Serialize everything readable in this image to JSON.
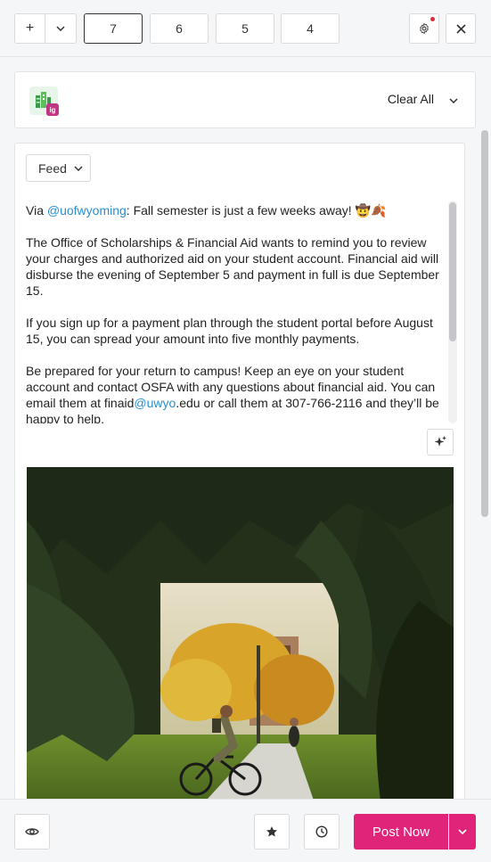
{
  "toolbar": {
    "add_label": "+",
    "tabs": [
      {
        "label": "7",
        "active": true
      },
      {
        "label": "6",
        "active": false
      },
      {
        "label": "5",
        "active": false
      },
      {
        "label": "4",
        "active": false
      }
    ]
  },
  "account": {
    "network_badge": "ig",
    "clear_all": "Clear All"
  },
  "editor": {
    "feed_label": "Feed",
    "caption": {
      "p1_prefix": "Via ",
      "p1_mention": "@uofwyoming",
      "p1_text": ": Fall semester is just a few weeks away! 🤠🍂",
      "p2": "The Office of Scholarships & Financial Aid wants to remind you to review your charges and authorized aid on your student account. Financial aid will disburse the evening of September 5 and payment in full is due September 15.",
      "p3": "If you sign up for a payment plan through the student portal before August 15, you can spread your amount into five monthly payments.",
      "p4_prefix": "Be prepared for your return to campus! Keep an eye on your student account and contact OSFA with any questions about financial aid. You can email them at finaid",
      "p4_mention": "@uwyo",
      "p4_suffix": ".edu or call them at 307-766-2116 and they’ll be happy to help."
    }
  },
  "bottom": {
    "post_now": "Post Now"
  },
  "colors": {
    "accent": "#e0247a",
    "mention": "#2a8fd0",
    "instagram": "#c13584"
  },
  "icons": [
    "plus-icon",
    "chevron-down-icon",
    "gear-icon",
    "close-icon",
    "sparkle-icon",
    "eye-icon",
    "star-icon",
    "clock-icon"
  ]
}
